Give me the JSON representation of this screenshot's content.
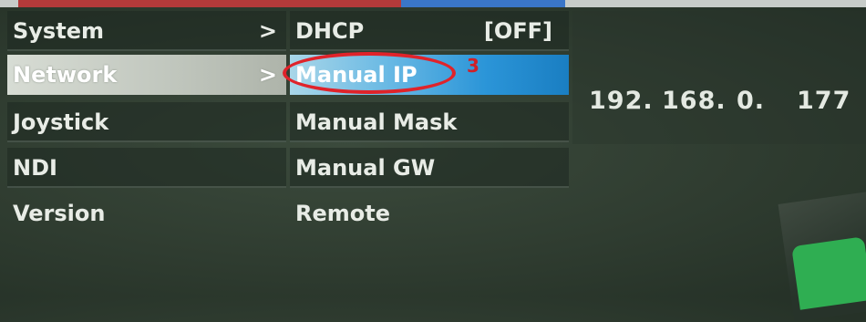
{
  "left_menu": {
    "items": [
      {
        "label": "System",
        "arrow": ">"
      },
      {
        "label": "Network",
        "arrow": ">"
      },
      {
        "label": "Joystick",
        "arrow": ""
      },
      {
        "label": "NDI",
        "arrow": ""
      },
      {
        "label": "Version",
        "arrow": ""
      }
    ],
    "selected_index": 1
  },
  "network_menu": {
    "items": [
      {
        "label": "DHCP",
        "value": "[OFF]"
      },
      {
        "label": "Manual IP",
        "value": ""
      },
      {
        "label": "Manual Mask",
        "value": ""
      },
      {
        "label": "Manual GW",
        "value": ""
      },
      {
        "label": "Remote",
        "value": ""
      }
    ],
    "selected_index": 1
  },
  "ip_value": {
    "octet1": "192.",
    "octet2": "168.",
    "octet3": "0.",
    "octet4": "177"
  },
  "annotation": {
    "number": "3",
    "color": "#e0232a"
  },
  "colors": {
    "selected_mid": "#2b95d8",
    "selected_left": "#c0c6bd",
    "background": "#2f3c30"
  }
}
